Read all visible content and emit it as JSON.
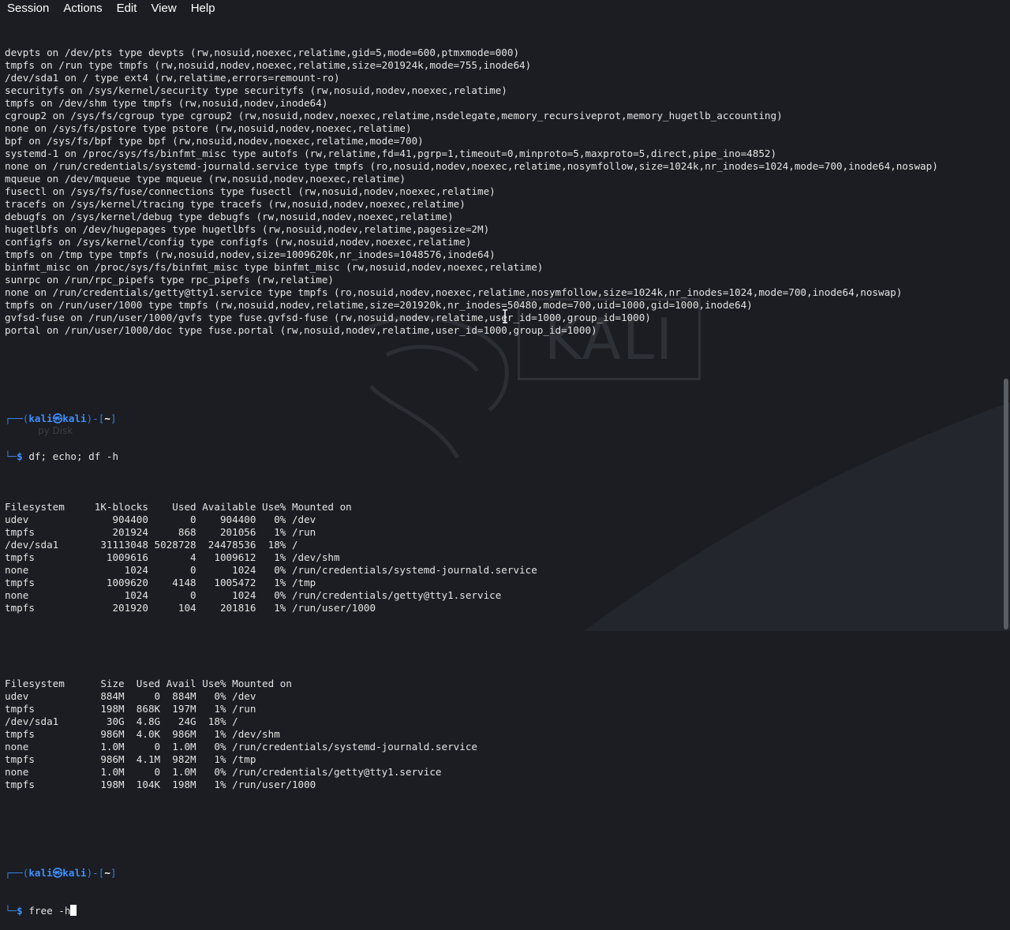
{
  "menubar": {
    "items": [
      "Session",
      "Actions",
      "Edit",
      "View",
      "Help"
    ]
  },
  "background": {
    "logo_text": "KALI",
    "desktop_icon_label": "py Disk"
  },
  "terminal": {
    "mount_lines": [
      "devpts on /dev/pts type devpts (rw,nosuid,noexec,relatime,gid=5,mode=600,ptmxmode=000)",
      "tmpfs on /run type tmpfs (rw,nosuid,nodev,noexec,relatime,size=201924k,mode=755,inode64)",
      "/dev/sda1 on / type ext4 (rw,relatime,errors=remount-ro)",
      "securityfs on /sys/kernel/security type securityfs (rw,nosuid,nodev,noexec,relatime)",
      "tmpfs on /dev/shm type tmpfs (rw,nosuid,nodev,inode64)",
      "cgroup2 on /sys/fs/cgroup type cgroup2 (rw,nosuid,nodev,noexec,relatime,nsdelegate,memory_recursiveprot,memory_hugetlb_accounting)",
      "none on /sys/fs/pstore type pstore (rw,nosuid,nodev,noexec,relatime)",
      "bpf on /sys/fs/bpf type bpf (rw,nosuid,nodev,noexec,relatime,mode=700)",
      "systemd-1 on /proc/sys/fs/binfmt_misc type autofs (rw,relatime,fd=41,pgrp=1,timeout=0,minproto=5,maxproto=5,direct,pipe_ino=4852)",
      "none on /run/credentials/systemd-journald.service type tmpfs (ro,nosuid,nodev,noexec,relatime,nosymfollow,size=1024k,nr_inodes=1024,mode=700,inode64,noswap)",
      "mqueue on /dev/mqueue type mqueue (rw,nosuid,nodev,noexec,relatime)",
      "fusectl on /sys/fs/fuse/connections type fusectl (rw,nosuid,nodev,noexec,relatime)",
      "tracefs on /sys/kernel/tracing type tracefs (rw,nosuid,nodev,noexec,relatime)",
      "debugfs on /sys/kernel/debug type debugfs (rw,nosuid,nodev,noexec,relatime)",
      "hugetlbfs on /dev/hugepages type hugetlbfs (rw,nosuid,nodev,relatime,pagesize=2M)",
      "configfs on /sys/kernel/config type configfs (rw,nosuid,nodev,noexec,relatime)",
      "tmpfs on /tmp type tmpfs (rw,nosuid,nodev,size=1009620k,nr_inodes=1048576,inode64)",
      "binfmt_misc on /proc/sys/fs/binfmt_misc type binfmt_misc (rw,nosuid,nodev,noexec,relatime)",
      "sunrpc on /run/rpc_pipefs type rpc_pipefs (rw,relatime)",
      "none on /run/credentials/getty@tty1.service type tmpfs (ro,nosuid,nodev,noexec,relatime,nosymfollow,size=1024k,nr_inodes=1024,mode=700,inode64,noswap)",
      "tmpfs on /run/user/1000 type tmpfs (rw,nosuid,nodev,relatime,size=201920k,nr_inodes=50480,mode=700,uid=1000,gid=1000,inode64)",
      "gvfsd-fuse on /run/user/1000/gvfs type fuse.gvfsd-fuse (rw,nosuid,nodev,relatime,user_id=1000,group_id=1000)",
      "portal on /run/user/1000/doc type fuse.portal (rw,nosuid,nodev,relatime,user_id=1000,group_id=1000)"
    ],
    "prompt1": {
      "frame_top": "┌──(",
      "user": "kali",
      "at": "㉿",
      "host": "kali",
      "mid": ")-[",
      "dir": "~",
      "end": "]",
      "frame_bottom": "└─",
      "dollar": "$ ",
      "command": "df; echo; df -h"
    },
    "df_lines": [
      "Filesystem     1K-blocks    Used Available Use% Mounted on",
      "udev              904400       0    904400   0% /dev",
      "tmpfs             201924     868    201056   1% /run",
      "/dev/sda1       31113048 5028728  24478536  18% /",
      "tmpfs            1009616       4   1009612   1% /dev/shm",
      "none                1024       0      1024   0% /run/credentials/systemd-journald.service",
      "tmpfs            1009620    4148   1005472   1% /tmp",
      "none                1024       0      1024   0% /run/credentials/getty@tty1.service",
      "tmpfs             201920     104    201816   1% /run/user/1000"
    ],
    "dfh_lines": [
      "Filesystem      Size  Used Avail Use% Mounted on",
      "udev            884M     0  884M   0% /dev",
      "tmpfs           198M  868K  197M   1% /run",
      "/dev/sda1        30G  4.8G   24G  18% /",
      "tmpfs           986M  4.0K  986M   1% /dev/shm",
      "none            1.0M     0  1.0M   0% /run/credentials/systemd-journald.service",
      "tmpfs           986M  4.1M  982M   1% /tmp",
      "none            1.0M     0  1.0M   0% /run/credentials/getty@tty1.service",
      "tmpfs           198M  104K  198M   1% /run/user/1000"
    ],
    "prompt2": {
      "frame_top": "┌──(",
      "user": "kali",
      "at": "㉿",
      "host": "kali",
      "mid": ")-[",
      "dir": "~",
      "end": "]",
      "frame_bottom": "└─",
      "dollar": "$ ",
      "command": "free -h"
    }
  },
  "colors": {
    "background": "#1b1d22",
    "prompt_blue": "#3f8fff",
    "text": "#e4e4e4"
  }
}
